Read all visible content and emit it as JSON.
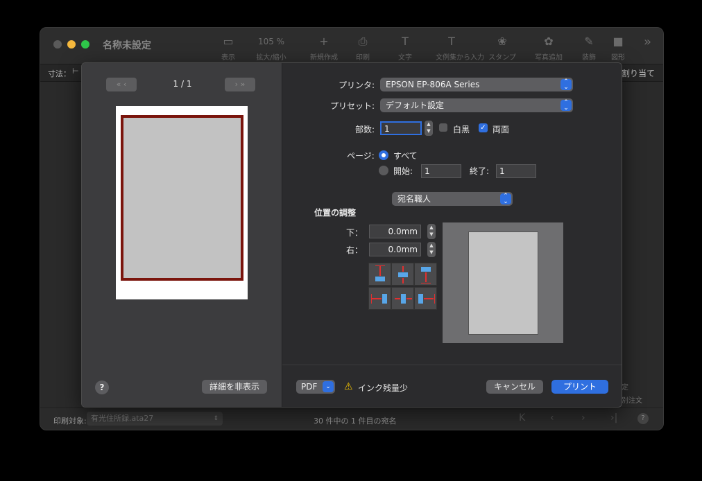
{
  "window": {
    "title": "名称未設定",
    "toolbar": [
      {
        "glyph": "▭",
        "label": "表示"
      },
      {
        "glyph": "105 %",
        "label": "拡大/縮小"
      },
      {
        "glyph": "+",
        "label": "新規作成"
      },
      {
        "glyph": "⎙",
        "label": "印刷"
      },
      {
        "glyph": "T",
        "label": "文字"
      },
      {
        "glyph": "T",
        "label": "文例集から入力"
      },
      {
        "glyph": "❀",
        "label": "スタンプ"
      },
      {
        "glyph": "✿",
        "label": "写真追加"
      },
      {
        "glyph": "✎",
        "label": "装飾"
      },
      {
        "glyph": "■",
        "label": "図形"
      }
    ],
    "strip_left": "寸法：",
    "strip_right": "割り当て",
    "right_texts": [
      "定",
      "別注文"
    ],
    "status": {
      "target_label": "印刷対象:",
      "target_value": "有光住所録.ata27",
      "count_text": "30 件中の 1 件目の宛名"
    }
  },
  "preview": {
    "page_counter": "1 / 1"
  },
  "print": {
    "printer_label": "プリンタ:",
    "printer_value": "EPSON EP-806A Series",
    "preset_label": "プリセット:",
    "preset_value": "デフォルト設定",
    "copies_label": "部数:",
    "copies_value": "1",
    "bw_label": "白黒",
    "bw_checked": false,
    "duplex_label": "両面",
    "duplex_checked": true,
    "pages_label": "ページ:",
    "all_label": "すべて",
    "from_label": "開始:",
    "from_value": "1",
    "to_label": "終了:",
    "to_value": "1",
    "app_popup": "宛名職人",
    "adjust_title": "位置の調整",
    "bottom_label": "下：",
    "bottom_value": "0.0mm",
    "right_label": "右：",
    "right_value": "0.0mm"
  },
  "footer": {
    "help": "?",
    "hide_details": "詳細を非表示",
    "pdf": "PDF",
    "warning": "インク残量少",
    "cancel": "キャンセル",
    "print": "プリント"
  },
  "colors": {
    "accent": "#2f6fe0",
    "card_border": "#7a140c",
    "warning": "#f5c400"
  }
}
